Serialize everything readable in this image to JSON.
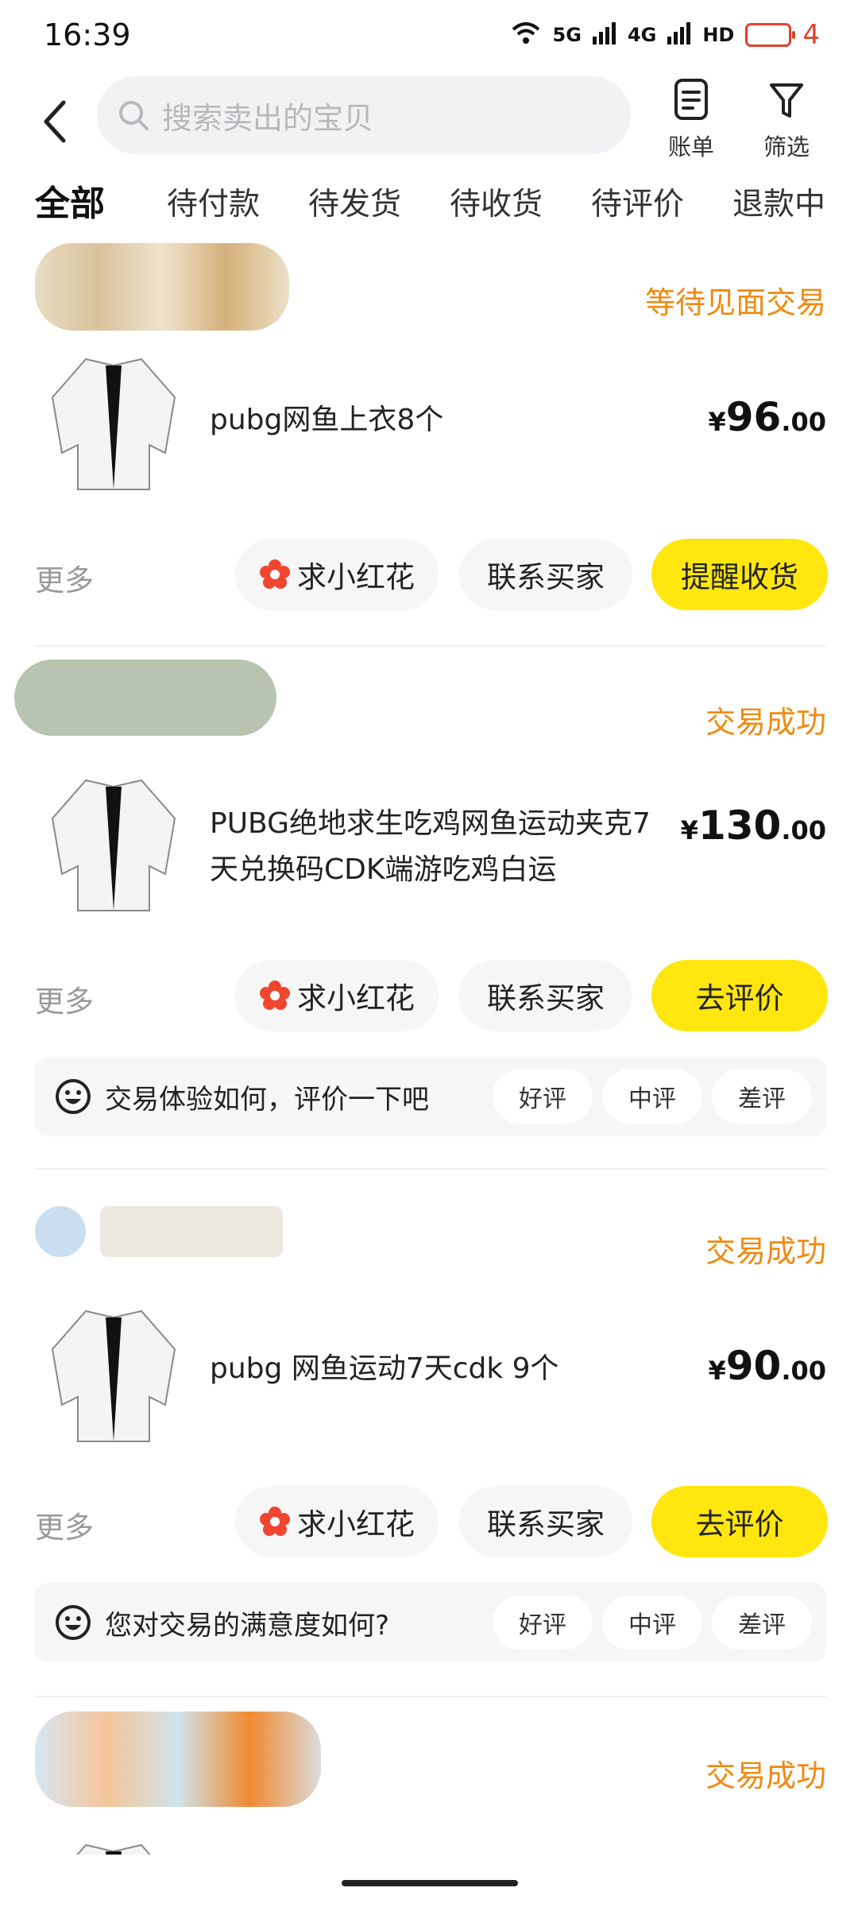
{
  "status_bar": {
    "time": "16:39",
    "network_5g": "5G",
    "network_4g": "4G",
    "hd": "HD",
    "battery": "4",
    "battery_color": "#e0412a"
  },
  "header": {
    "search_placeholder": "搜索卖出的宝贝",
    "bill_label": "账单",
    "filter_label": "筛选"
  },
  "tabs": [
    "全部",
    "待付款",
    "待发货",
    "待收货",
    "待评价",
    "退款中"
  ],
  "accent_yellow": "#ffe60f",
  "status_orange": "#f08a10",
  "orders": [
    {
      "status": "等待见面交易",
      "title": "pubg网鱼上衣8个",
      "price": {
        "currency": "¥",
        "int": "96",
        "dec": ".00"
      },
      "more": "更多",
      "actions": [
        "求小红花",
        "联系买家",
        "提醒收货"
      ]
    },
    {
      "status": "交易成功",
      "title": "PUBG绝地求生吃鸡网鱼运动夹克7天兑换码CDK端游吃鸡白运",
      "price": {
        "currency": "¥",
        "int": "130",
        "dec": ".00"
      },
      "more": "更多",
      "actions": [
        "求小红花",
        "联系买家",
        "去评价"
      ],
      "eval": {
        "question": "交易体验如何，评价一下吧",
        "options": [
          "好评",
          "中评",
          "差评"
        ]
      }
    },
    {
      "status": "交易成功",
      "title": "pubg 网鱼运动7天cdk 9个",
      "price": {
        "currency": "¥",
        "int": "90",
        "dec": ".00"
      },
      "more": "更多",
      "actions": [
        "求小红花",
        "联系买家",
        "去评价"
      ],
      "eval": {
        "question": "您对交易的满意度如何?",
        "options": [
          "好评",
          "中评",
          "差评"
        ]
      }
    },
    {
      "status": "交易成功"
    }
  ]
}
